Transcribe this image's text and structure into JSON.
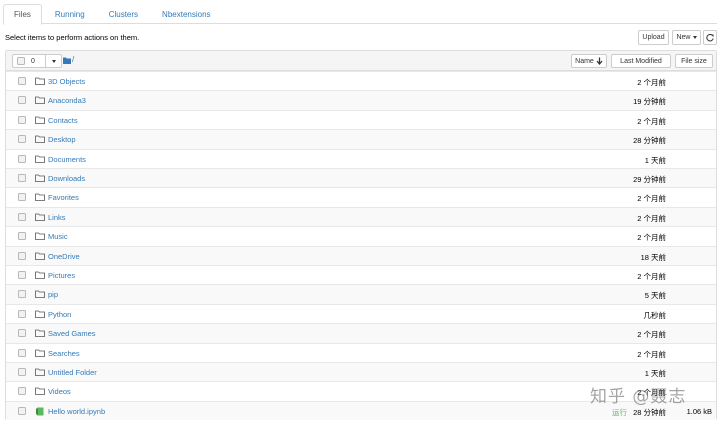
{
  "tabs": [
    {
      "label": "Files",
      "active": true
    },
    {
      "label": "Running",
      "active": false
    },
    {
      "label": "Clusters",
      "active": false
    },
    {
      "label": "Nbextensions",
      "active": false
    }
  ],
  "toolbar": {
    "select_hint": "Select items to perform actions on them.",
    "upload_label": "Upload",
    "new_label": "New",
    "refresh_icon": "refresh-icon"
  },
  "list_header": {
    "selected_count": "0",
    "path": "/",
    "sort_name_label": "Name",
    "last_modified_label": "Last Modified",
    "file_size_label": "File size"
  },
  "items": [
    {
      "type": "folder",
      "name": "3D Objects",
      "modified": "2 个月前",
      "size": ""
    },
    {
      "type": "folder",
      "name": "Anaconda3",
      "modified": "19 分钟前",
      "size": ""
    },
    {
      "type": "folder",
      "name": "Contacts",
      "modified": "2 个月前",
      "size": ""
    },
    {
      "type": "folder",
      "name": "Desktop",
      "modified": "28 分钟前",
      "size": ""
    },
    {
      "type": "folder",
      "name": "Documents",
      "modified": "1 天前",
      "size": ""
    },
    {
      "type": "folder",
      "name": "Downloads",
      "modified": "29 分钟前",
      "size": ""
    },
    {
      "type": "folder",
      "name": "Favorites",
      "modified": "2 个月前",
      "size": ""
    },
    {
      "type": "folder",
      "name": "Links",
      "modified": "2 个月前",
      "size": ""
    },
    {
      "type": "folder",
      "name": "Music",
      "modified": "2 个月前",
      "size": ""
    },
    {
      "type": "folder",
      "name": "OneDrive",
      "modified": "18 天前",
      "size": ""
    },
    {
      "type": "folder",
      "name": "Pictures",
      "modified": "2 个月前",
      "size": ""
    },
    {
      "type": "folder",
      "name": "pip",
      "modified": "5 天前",
      "size": ""
    },
    {
      "type": "folder",
      "name": "Python",
      "modified": "几秒前",
      "size": ""
    },
    {
      "type": "folder",
      "name": "Saved Games",
      "modified": "2 个月前",
      "size": ""
    },
    {
      "type": "folder",
      "name": "Searches",
      "modified": "2 个月前",
      "size": ""
    },
    {
      "type": "folder",
      "name": "Untitled Folder",
      "modified": "1 天前",
      "size": ""
    },
    {
      "type": "folder",
      "name": "Videos",
      "modified": "2 个月前",
      "size": ""
    },
    {
      "type": "notebook",
      "name": "Hello world.ipynb",
      "modified": "28 分钟前",
      "size": "1.06 kB",
      "status": "运行"
    }
  ],
  "watermark": "知乎 @聂志",
  "colors": {
    "link": "#337ab7",
    "running": "#5cb85c",
    "folder_icon": "#555555",
    "notebook_icon": "#5cb85c"
  }
}
